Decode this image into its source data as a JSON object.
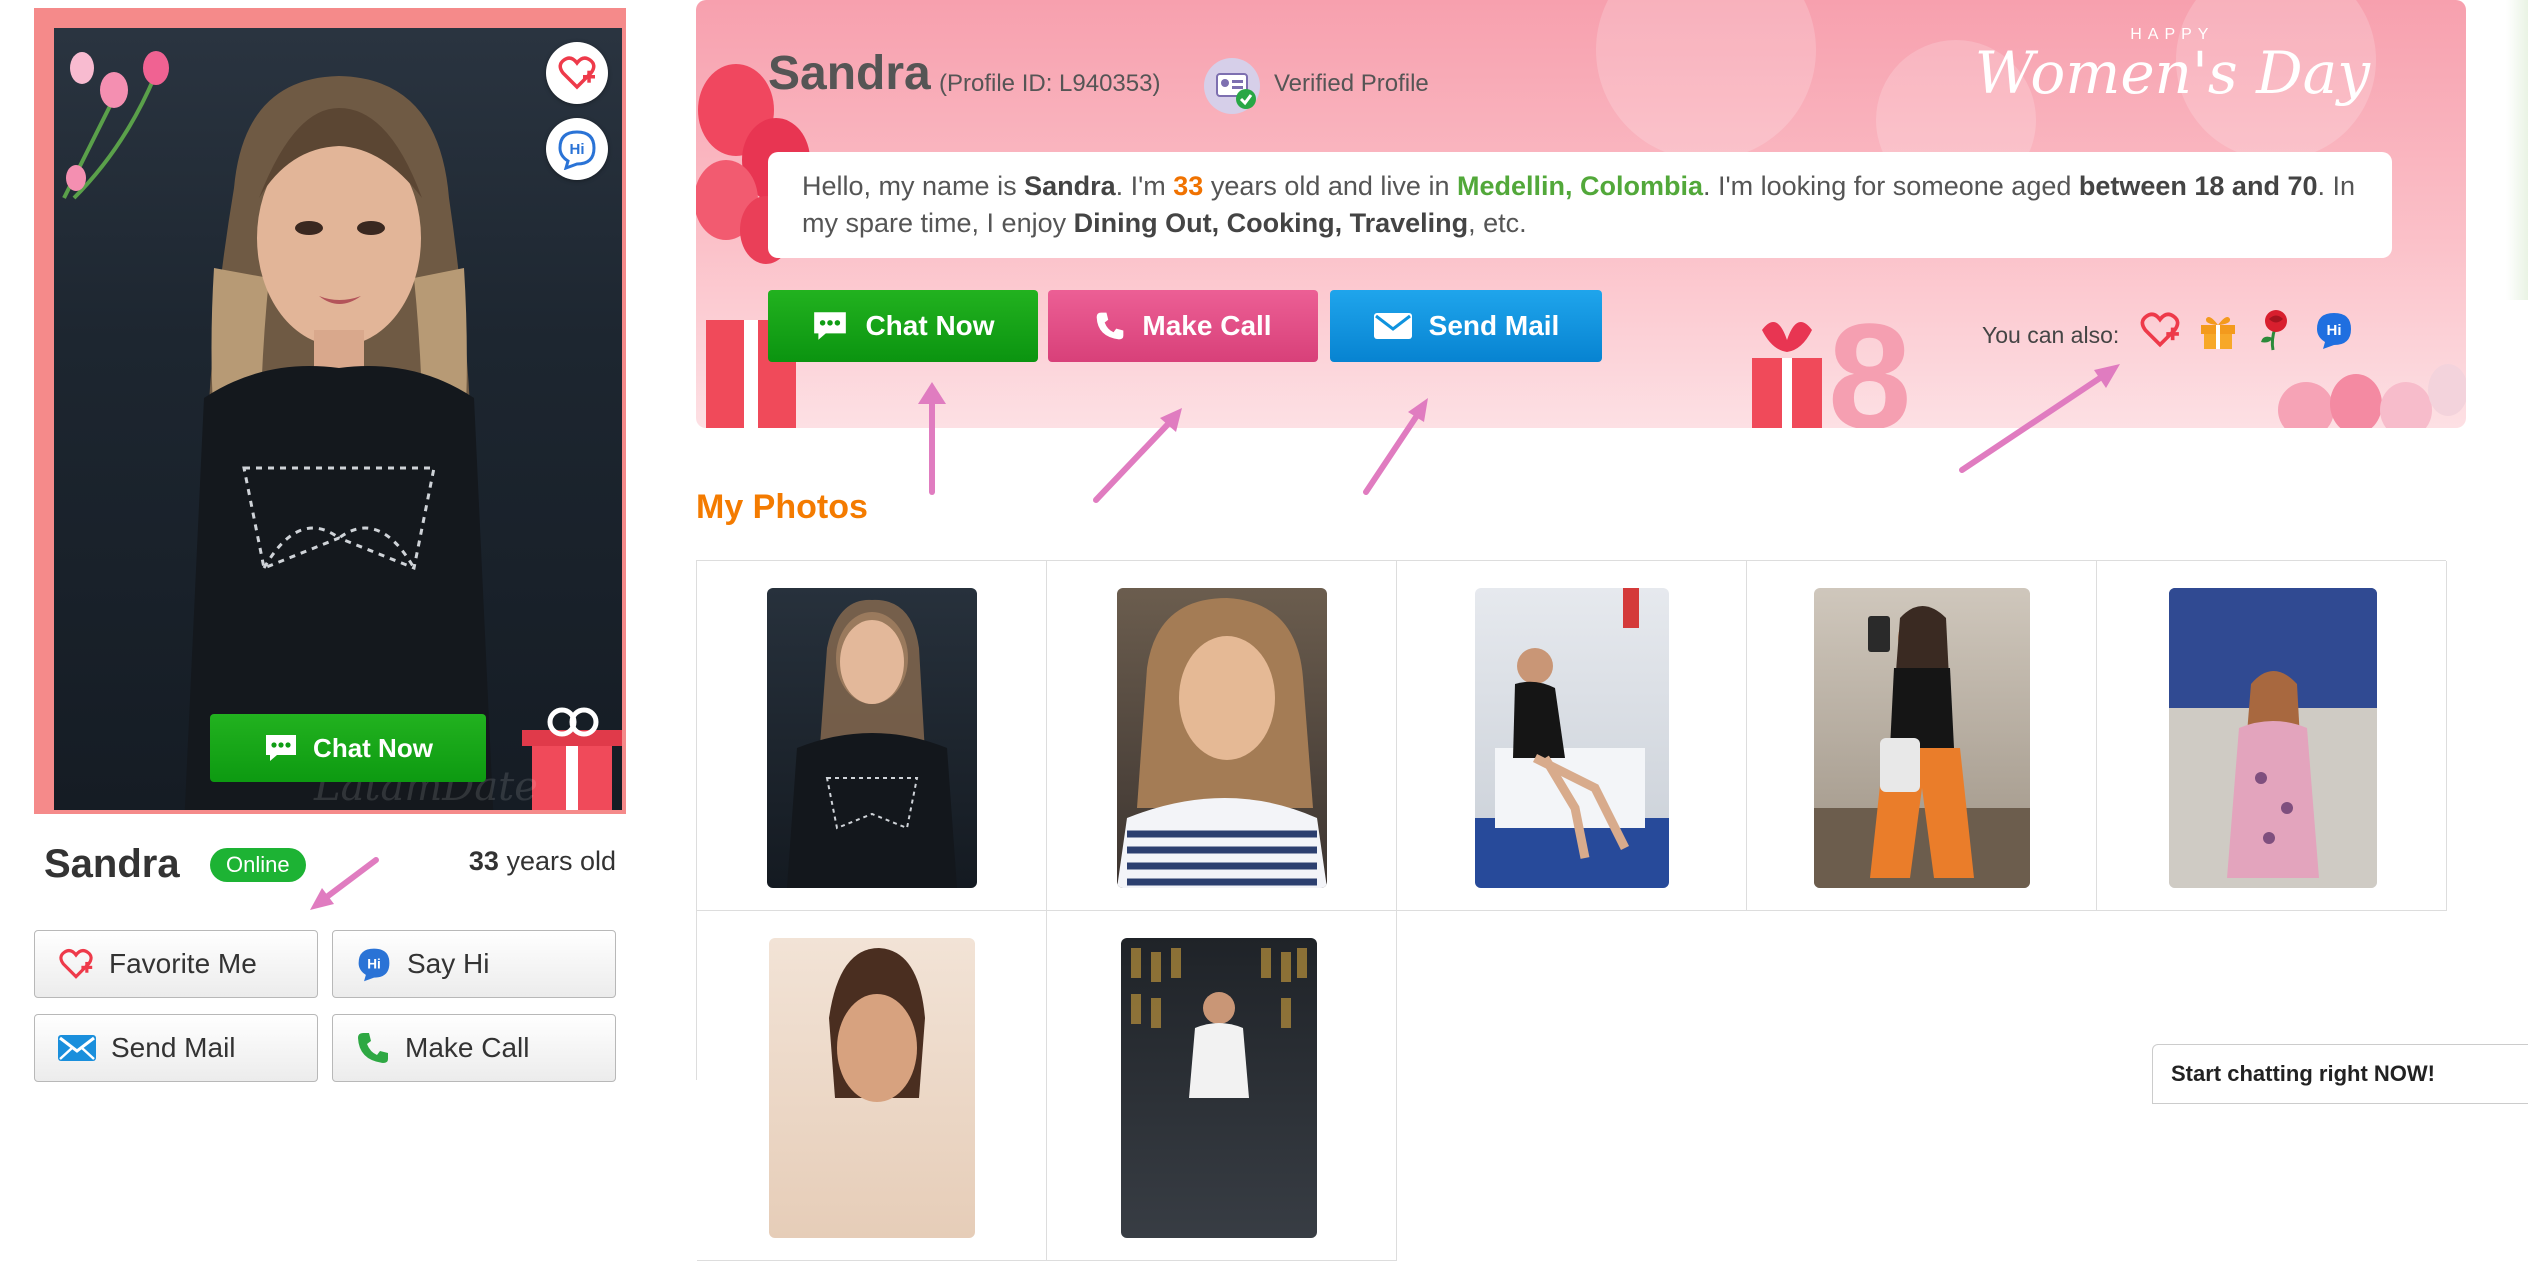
{
  "left_panel": {
    "chat_now_label": "Chat Now",
    "watermark": "LatamDate",
    "name": "Sandra",
    "status_badge": "Online",
    "age_number": "33",
    "age_suffix": " years old",
    "buttons": {
      "favorite": "Favorite Me",
      "say_hi": "Say Hi",
      "send_mail": "Send Mail",
      "make_call": "Make Call"
    }
  },
  "header": {
    "name": "Sandra",
    "profile_id": "(Profile ID: L940353)",
    "verified": "Verified Profile",
    "banner_small": "HAPPY",
    "banner_big": "Women's Day",
    "bio": {
      "p1": "Hello, my name is ",
      "name": "Sandra",
      "p2": ". I'm ",
      "age": "33",
      "p3": " years old and live in ",
      "location": "Medellin, Colombia",
      "p4": ". I'm looking for someone aged ",
      "age_range": "between 18 and 70",
      "p5": ". In my spare time, I enjoy ",
      "hobbies": "Dining Out, Cooking, Traveling",
      "p6": ", etc."
    },
    "actions": {
      "chat": "Chat Now",
      "call": "Make Call",
      "mail": "Send Mail"
    },
    "you_can_also": "You can also:"
  },
  "photos": {
    "title": "My Photos"
  },
  "chat_popup": {
    "text": "Start chatting right NOW!"
  },
  "icons": {
    "favorite": "heart-plus-icon",
    "hi": "hi-bubble-icon",
    "chat": "chat-bubble-icon",
    "call": "phone-icon",
    "mail": "envelope-icon",
    "gift": "gift-icon",
    "rose": "rose-icon"
  },
  "colors": {
    "chat_green": "#14a516",
    "call_pink": "#e2508a",
    "mail_blue": "#0f93de",
    "accent_orange": "#f47b00",
    "location_green": "#52a83a",
    "frame_coral": "#f58a8a",
    "arrow_pink": "#e07cc0"
  }
}
